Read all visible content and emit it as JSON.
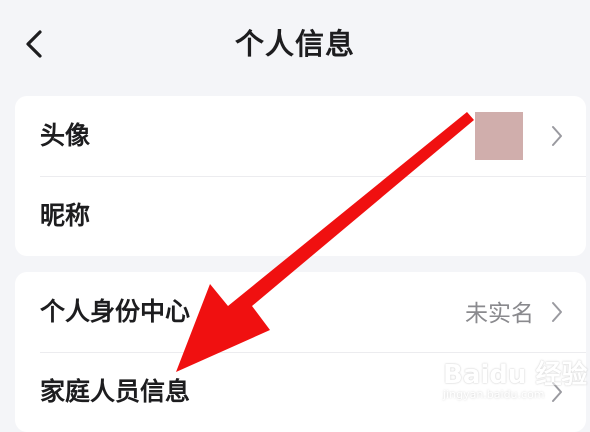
{
  "header": {
    "title": "个人信息",
    "back_icon": "chevron-left-icon"
  },
  "profile_card": {
    "rows": [
      {
        "label": "头像",
        "value": "",
        "has_avatar": true,
        "icon": "chevron-right-icon"
      },
      {
        "label": "昵称",
        "value": "",
        "icon": "chevron-right-icon"
      }
    ]
  },
  "identity_card": {
    "rows": [
      {
        "label": "个人身份中心",
        "value": "未实名",
        "icon": "chevron-right-icon"
      },
      {
        "label": "家庭人员信息",
        "value": "",
        "icon": "chevron-right-icon"
      }
    ]
  },
  "annotation": {
    "type": "arrow",
    "color": "#f01010"
  },
  "watermark": {
    "brand": "Baidu 经验",
    "url": "jingyan.baidu.com"
  },
  "colors": {
    "background": "#f4f5f8",
    "card": "#ffffff",
    "secondary_text": "#8a8a8e",
    "avatar_placeholder": "#d0aeac"
  }
}
